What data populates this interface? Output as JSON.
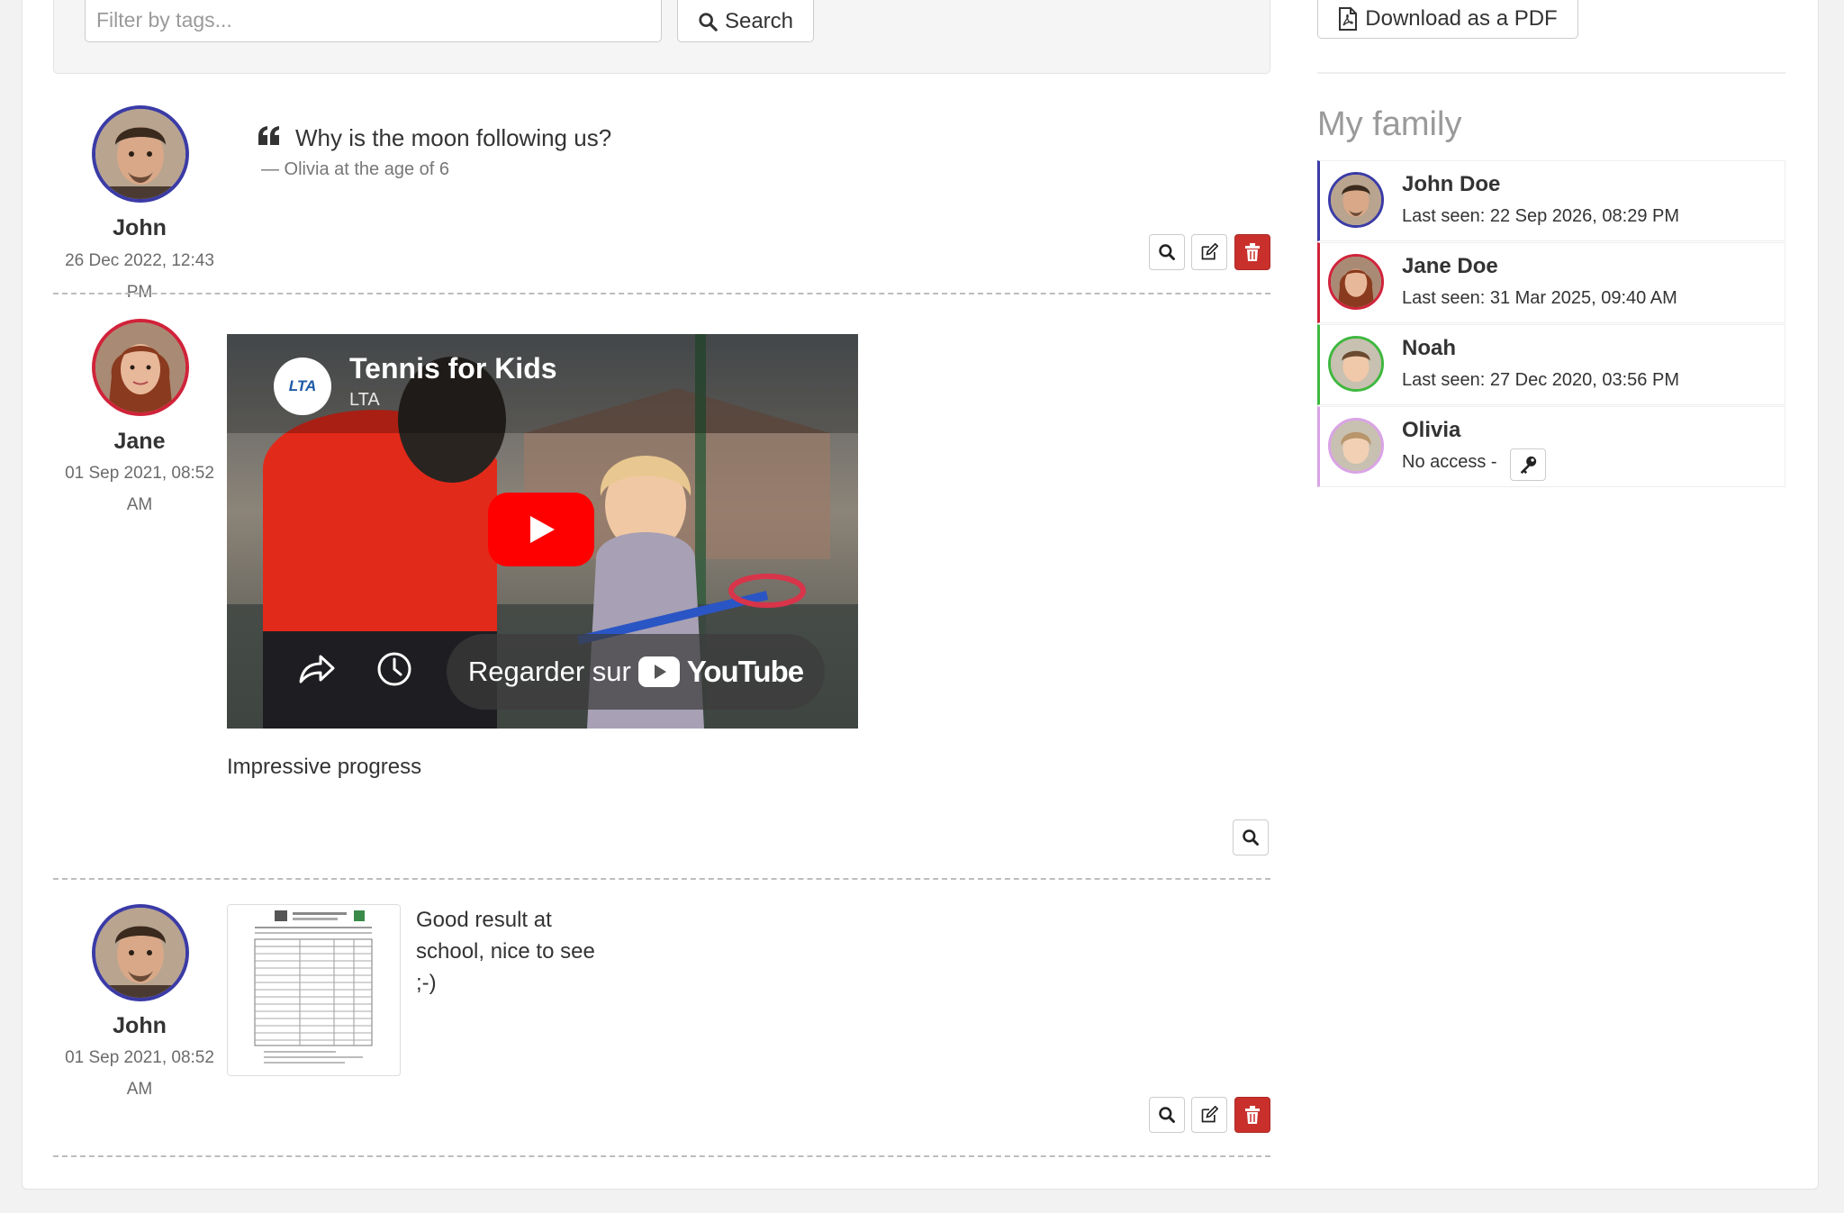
{
  "filter": {
    "placeholder": "Filter by tags...",
    "search_label": "Search",
    "download_label": "Download as a PDF"
  },
  "posts": [
    {
      "type": "quote",
      "author": "John",
      "date_line1": "26 Dec 2022, 12:43",
      "date_line2": "PM",
      "avatar_color": "#3b3ba6",
      "quote": "Why is the moon following us?",
      "source": "— Olivia at the age of 6"
    },
    {
      "type": "video",
      "author": "Jane",
      "date_line1": "01 Sep 2021, 08:52",
      "date_line2": "AM",
      "avatar_color": "#d0233a",
      "video_title": "Tennis for Kids",
      "video_channel": "LTA",
      "channel_logo_text": "LTA",
      "watch_label": "Regarder sur",
      "watch_brand": "YouTube",
      "caption": "Impressive progress"
    },
    {
      "type": "document",
      "author": "John",
      "date_line1": "01 Sep 2021, 08:52",
      "date_line2": "AM",
      "avatar_color": "#3b3ba6",
      "text": "Good result at school, nice to see ;-)"
    }
  ],
  "family": {
    "title": "My family",
    "members": [
      {
        "name": "John Doe",
        "status": "Last seen: 22 Sep 2026, 08:29 PM",
        "color": "#3b3ba6"
      },
      {
        "name": "Jane Doe",
        "status": "Last seen: 31 Mar 2025, 09:40 AM",
        "color": "#d0233a"
      },
      {
        "name": "Noah",
        "status": "Last seen: 27 Dec 2020, 03:56 PM",
        "color": "#3fb83f"
      },
      {
        "name": "Olivia",
        "status": "No access -",
        "color": "#d9a3e6"
      }
    ]
  },
  "colors": {
    "danger": "#c9302c",
    "john": "#3b3ba6",
    "jane": "#d0233a",
    "noah": "#3fb83f",
    "olivia": "#d9a3e6"
  },
  "icons": [
    "search-icon",
    "file-pdf-icon",
    "quote-icon",
    "zoom-icon",
    "edit-icon",
    "trash-icon",
    "play-icon",
    "share-icon",
    "clock-icon",
    "key-icon"
  ]
}
